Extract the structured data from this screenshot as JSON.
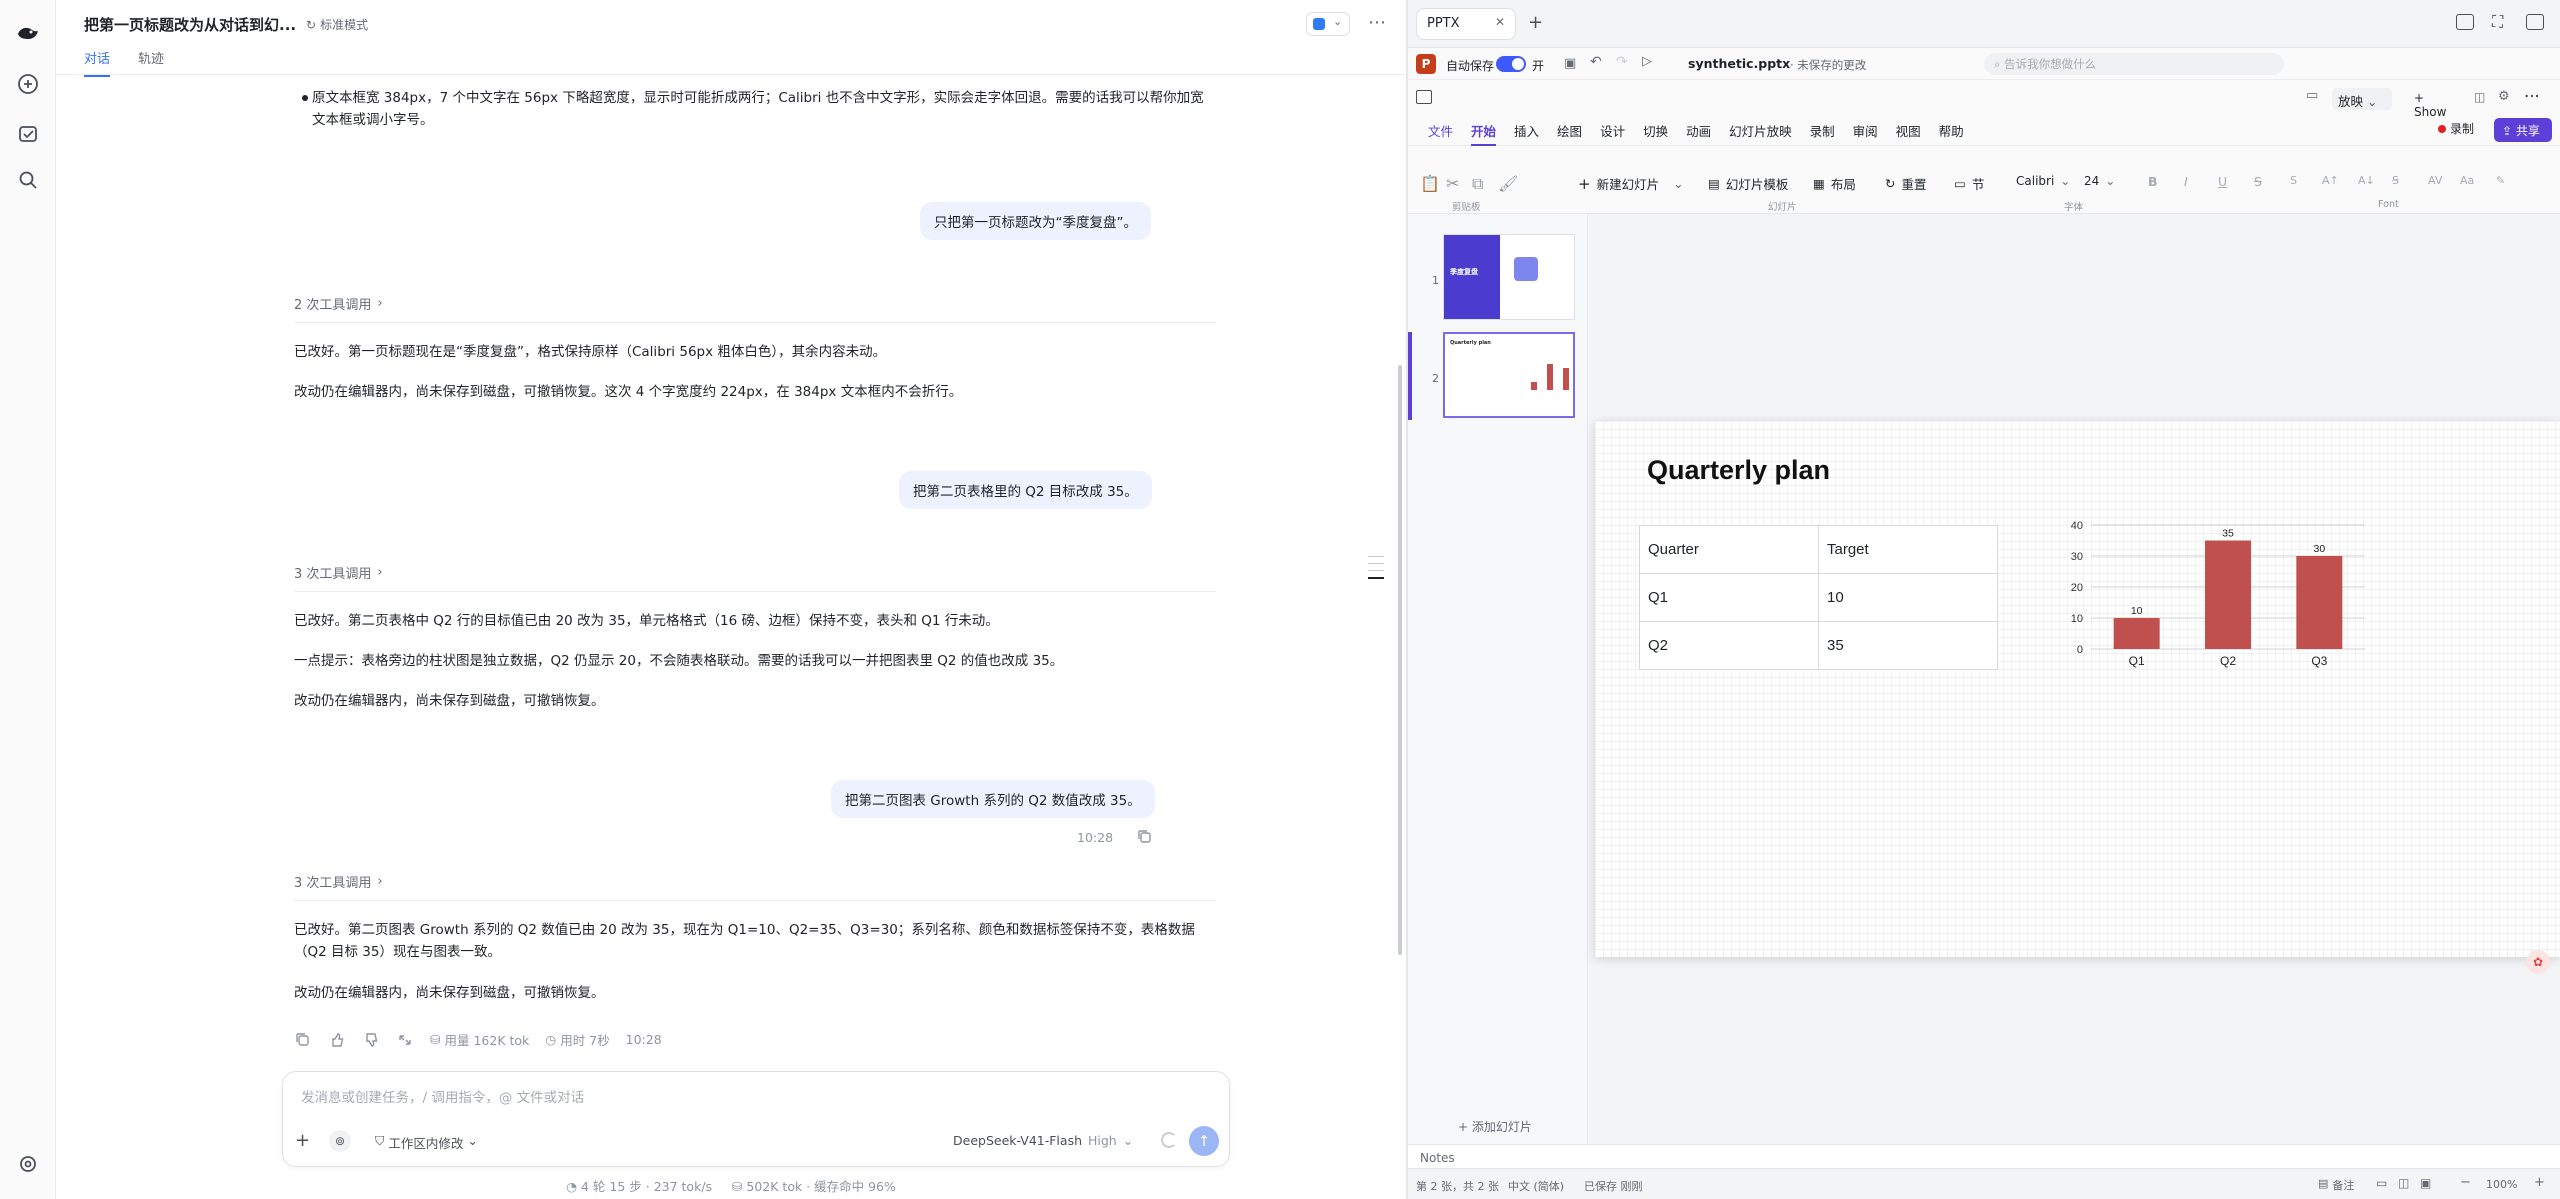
{
  "chat": {
    "title": "把第一页标题改为从对话到幻...",
    "mode": "标准模式",
    "tabs": [
      "对话",
      "轨迹"
    ],
    "truncated_bullet": "原文本框宽 384px，7 个中文字在 56px 下略超宽度，显示时可能折成两行；Calibri 也不含中文字形，实际会走字体回退。需要的话我可以帮你加宽文本框或调小字号。",
    "messages": [
      {
        "role": "user",
        "text": "只把第一页标题改为“季度复盘”。"
      },
      {
        "role": "tool",
        "text": "2 次工具调用"
      },
      {
        "role": "assistant",
        "paragraphs": [
          "已改好。第一页标题现在是“季度复盘”，格式保持原样（Calibri 56px 粗体白色），其余内容未动。",
          "改动仍在编辑器内，尚未保存到磁盘，可撤销恢复。这次 4 个字宽度约 224px，在 384px 文本框内不会折行。"
        ]
      },
      {
        "role": "user",
        "text": "把第二页表格里的 Q2 目标改成 35。"
      },
      {
        "role": "tool",
        "text": "3 次工具调用"
      },
      {
        "role": "assistant",
        "paragraphs": [
          "已改好。第二页表格中 Q2 行的目标值已由 20 改为 35，单元格格式（16 磅、边框）保持不变，表头和 Q1 行未动。",
          "一点提示：表格旁边的柱状图是独立数据，Q2 仍显示 20，不会随表格联动。需要的话我可以一并把图表里 Q2 的值也改成 35。",
          "改动仍在编辑器内，尚未保存到磁盘，可撤销恢复。"
        ]
      },
      {
        "role": "user",
        "text": "把第二页图表 Growth 系列的 Q2 数值改成 35。",
        "time": "10:28"
      },
      {
        "role": "tool",
        "text": "3 次工具调用"
      },
      {
        "role": "assistant",
        "paragraphs": [
          "已改好。第二页图表 Growth 系列的 Q2 数值已由 20 改为 35，现在为 Q1=10、Q2=35、Q3=30；系列名称、颜色和数据标签保持不变，表格数据（Q2 目标 35）现在与图表一致。",
          "改动仍在编辑器内，尚未保存到磁盘，可撤销恢复。"
        ]
      }
    ],
    "stats": {
      "usage": "用量 162K tok",
      "time_used": "用时 7秒",
      "clock": "10:28"
    },
    "composer": {
      "placeholder": "发消息或创建任务，/ 调用指令，@ 文件或对话",
      "scope": "工作区内修改",
      "model": "DeepSeek-V41-Flash",
      "effort": "High"
    },
    "footer": {
      "rounds": "4 轮 15 步 · 237 tok/s",
      "tokens": "502K tok · 缓存命中 96%"
    }
  },
  "ppt": {
    "tab": "PPTX",
    "autosave_label": "自动保存",
    "autosave_state": "开",
    "filename": "synthetic.pptx",
    "unsaved": "· 未保存的更改",
    "search_placeholder": "告诉我你想做什么",
    "present_label": "放映",
    "show_label": "+ Show",
    "record_label": "录制",
    "share_label": "共享",
    "menus": [
      "文件",
      "开始",
      "插入",
      "绘图",
      "设计",
      "切换",
      "动画",
      "幻灯片放映",
      "录制",
      "审阅",
      "视图",
      "帮助"
    ],
    "ribbon": {
      "new_slide": "新建幻灯片",
      "template": "幻灯片模板",
      "layout": "布局",
      "reset": "重置",
      "section": "节",
      "font": "Calibri",
      "size": "24",
      "clipboard": "剪贴板",
      "slides": "幻灯片",
      "font_group": "字体",
      "font_group2": "Font"
    },
    "thumbs": [
      {
        "num": "1",
        "title": "季度复盘"
      },
      {
        "num": "2",
        "title": "Quarterly plan"
      }
    ],
    "add_slide": "添加幻灯片",
    "slide": {
      "title": "Quarterly plan",
      "table": [
        [
          "Quarter",
          "Target"
        ],
        [
          "Q1",
          "10"
        ],
        [
          "Q2",
          "35"
        ]
      ]
    },
    "notes": "Notes",
    "status": {
      "slide": "第 2 张，共 2 张",
      "lang": "中文 (简体)",
      "saved": "已保存 刚刚",
      "notes_btn": "备注",
      "zoom": "100%"
    }
  },
  "chart_data": {
    "type": "bar",
    "categories": [
      "Q1",
      "Q2",
      "Q3"
    ],
    "series": [
      {
        "values": [
          10,
          35,
          30
        ],
        "color": "#c0504d"
      }
    ],
    "ylim": [
      0,
      40
    ],
    "yticks": [
      0,
      10,
      20,
      30,
      40
    ],
    "grid": true,
    "data_labels": true
  }
}
